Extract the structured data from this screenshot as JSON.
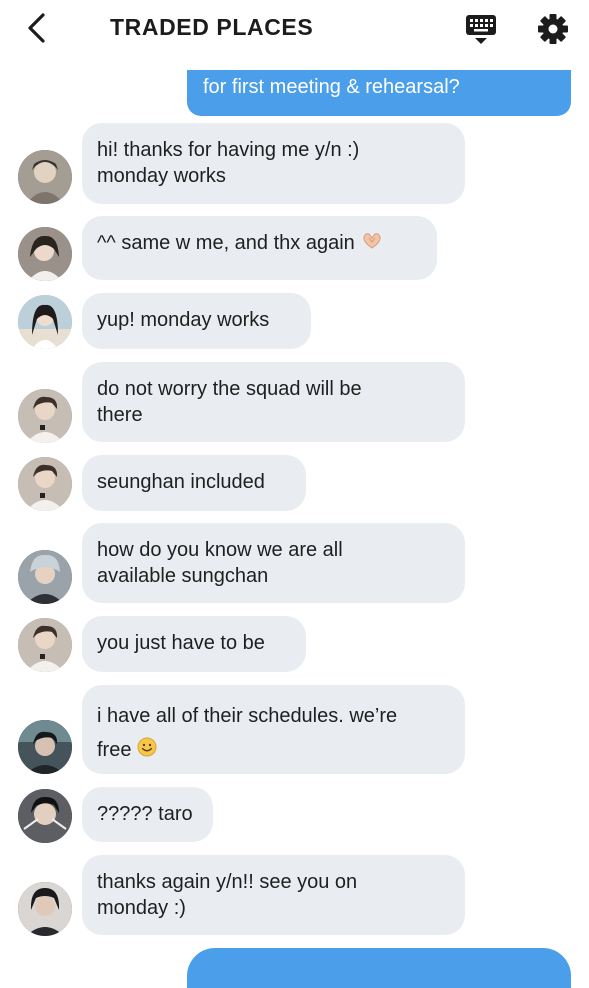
{
  "header": {
    "title": "TRADED PLACES",
    "icons": [
      "back-chevron-icon",
      "keyboard-icon",
      "gear-icon"
    ]
  },
  "outgoing_top": {
    "text": "for first meeting & rehearsal?"
  },
  "messages": [
    {
      "text": "hi! thanks for having me y/n :)\nmonday works",
      "avatar_color": "#6b655d"
    },
    {
      "text": "^^ same w me, and thx again",
      "emoji": "heart-hands-emoji",
      "avatar_color": "#7c6f66"
    },
    {
      "text": "yup! monday works",
      "avatar_color": "#8aa6b6"
    },
    {
      "text": "do not worry the squad will be\nthere",
      "avatar_color": "#8a7f79"
    },
    {
      "text": "seunghan included",
      "avatar_color": "#8a7f79"
    },
    {
      "text": "how do you know we are all\navailable sungchan",
      "avatar_color": "#5f6770"
    },
    {
      "text": "you just have to be",
      "avatar_color": "#8a7f79"
    },
    {
      "text": "i have all of their schedules. we’re\nfree",
      "emoji": "smiling-face-emoji",
      "avatar_color": "#3f4a4f"
    },
    {
      "text": "????? taro",
      "avatar_color": "#56585d"
    },
    {
      "text": "thanks again y/n!! see you on\nmonday :)",
      "avatar_color": "#4b4c52"
    }
  ],
  "colors": {
    "outgoing": "#4a9eea",
    "incoming": "#e9edf1",
    "text": "#1f1f1f"
  }
}
